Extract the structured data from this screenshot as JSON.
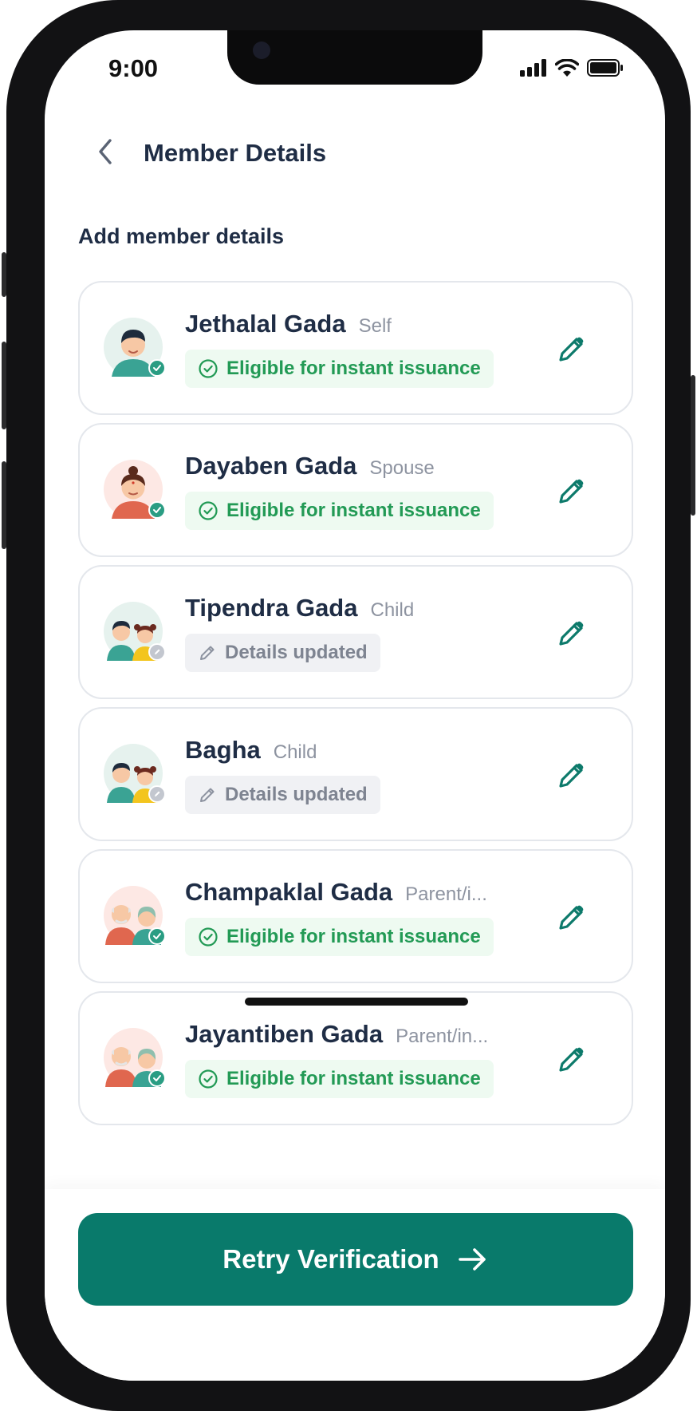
{
  "status_bar": {
    "time": "9:00"
  },
  "header": {
    "title": "Member Details"
  },
  "section_title": "Add member details",
  "members": [
    {
      "name": "Jethalal Gada",
      "relation": "Self",
      "status": "Eligible for instant issuance",
      "status_type": "eligible",
      "avatar": "single-male"
    },
    {
      "name": "Dayaben Gada",
      "relation": "Spouse",
      "status": "Eligible for instant issuance",
      "status_type": "eligible",
      "avatar": "single-female"
    },
    {
      "name": "Tipendra Gada",
      "relation": "Child",
      "status": "Details updated",
      "status_type": "updated",
      "avatar": "children"
    },
    {
      "name": "Bagha",
      "relation": "Child",
      "status": "Details updated",
      "status_type": "updated",
      "avatar": "children"
    },
    {
      "name": "Champaklal Gada",
      "relation": "Parent/i...",
      "status": "Eligible for instant issuance",
      "status_type": "eligible",
      "avatar": "parents"
    },
    {
      "name": "Jayantiben Gada",
      "relation": "Parent/in...",
      "status": "Eligible for instant issuance",
      "status_type": "eligible",
      "avatar": "parents"
    }
  ],
  "cta": {
    "label": "Retry Verification",
    "icon": "arrow-right-icon"
  },
  "colors": {
    "primary": "#097a6b",
    "eligible_text": "#229a55",
    "eligible_bg": "#eefaf1",
    "updated_text": "#7e8491",
    "updated_bg": "#f0f1f4"
  }
}
